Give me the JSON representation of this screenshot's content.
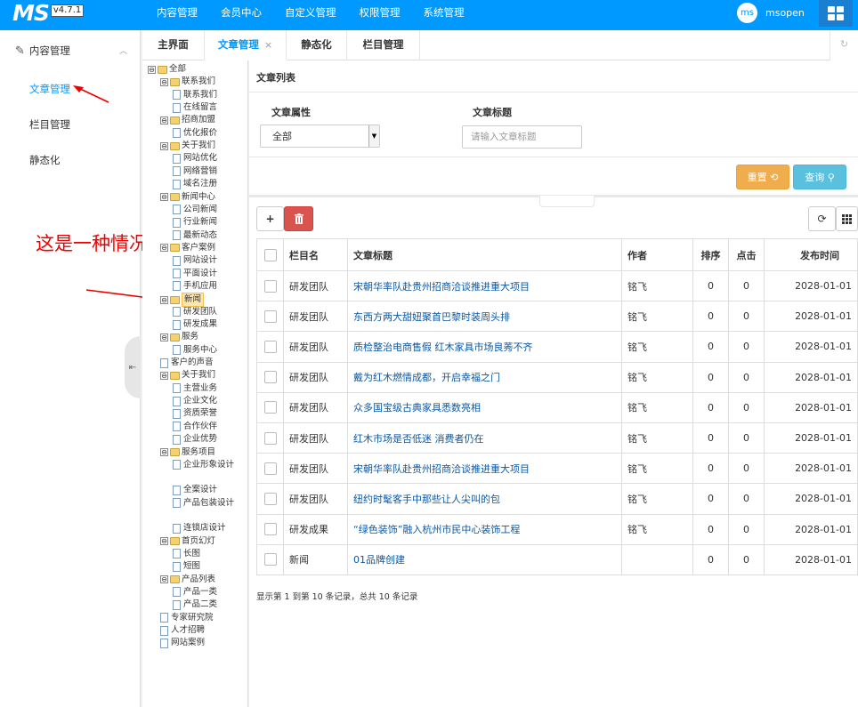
{
  "app": {
    "logo": "MS",
    "version": "v4.7.1"
  },
  "topnav": [
    "内容管理",
    "会员中心",
    "自定义管理",
    "权限管理",
    "系统管理"
  ],
  "user": {
    "avatar": "ms",
    "name": "msopen"
  },
  "sidebar": {
    "group": "内容管理",
    "items": [
      {
        "label": "文章管理",
        "active": true
      },
      {
        "label": "栏目管理",
        "active": false
      },
      {
        "label": "静态化",
        "active": false
      }
    ]
  },
  "annotation": {
    "text": "这是一种情况"
  },
  "tabs": [
    {
      "label": "主界面"
    },
    {
      "label": "文章管理",
      "close": "×"
    },
    {
      "label": "静态化"
    },
    {
      "label": "栏目管理"
    }
  ],
  "tree": [
    {
      "label": "全部",
      "type": "folder",
      "exp": "⊖"
    },
    {
      "label": "联系我们",
      "type": "folder",
      "exp": "⊖"
    },
    {
      "label": "联系我们",
      "type": "page"
    },
    {
      "label": "在线留言",
      "type": "page"
    },
    {
      "label": "招商加盟",
      "type": "folder",
      "exp": "⊖"
    },
    {
      "label": "优化报价",
      "type": "page"
    },
    {
      "label": "关于我们",
      "type": "folder",
      "exp": "⊖"
    },
    {
      "label": "网站优化",
      "type": "page"
    },
    {
      "label": "网络营销",
      "type": "page"
    },
    {
      "label": "域名注册",
      "type": "page"
    },
    {
      "label": "新闻中心",
      "type": "folder",
      "exp": "⊖"
    },
    {
      "label": "公司新闻",
      "type": "page"
    },
    {
      "label": "行业新闻",
      "type": "page"
    },
    {
      "label": "最新动态",
      "type": "page"
    },
    {
      "label": "客户案例",
      "type": "folder",
      "exp": "⊖"
    },
    {
      "label": "网站设计",
      "type": "page"
    },
    {
      "label": "平面设计",
      "type": "page"
    },
    {
      "label": "手机应用",
      "type": "page"
    },
    {
      "label": "新闻",
      "type": "folder",
      "exp": "⊖",
      "selected": true
    },
    {
      "label": "研发团队",
      "type": "page"
    },
    {
      "label": "研发成果",
      "type": "page"
    },
    {
      "label": "服务",
      "type": "folder",
      "exp": "⊖"
    },
    {
      "label": "服务中心",
      "type": "page"
    },
    {
      "label": "客户的声音",
      "type": "page"
    },
    {
      "label": "关于我们",
      "type": "folder",
      "exp": "⊖"
    },
    {
      "label": "主营业务",
      "type": "page"
    },
    {
      "label": "企业文化",
      "type": "page"
    },
    {
      "label": "资质荣誉",
      "type": "page"
    },
    {
      "label": "合作伙伴",
      "type": "page"
    },
    {
      "label": "企业优势",
      "type": "page"
    },
    {
      "label": "服务项目",
      "type": "folder",
      "exp": "⊖"
    },
    {
      "label": "企业形象设计",
      "type": "page",
      "wrap": true
    },
    {
      "label": "全案设计",
      "type": "page"
    },
    {
      "label": "产品包装设计",
      "type": "page",
      "wrap": true
    },
    {
      "label": "连锁店设计",
      "type": "page"
    },
    {
      "label": "首页幻灯",
      "type": "folder",
      "exp": "⊖"
    },
    {
      "label": "长图",
      "type": "page"
    },
    {
      "label": "短图",
      "type": "page"
    },
    {
      "label": "产品列表",
      "type": "folder",
      "exp": "⊖"
    },
    {
      "label": "产品一类",
      "type": "page"
    },
    {
      "label": "产品二类",
      "type": "page"
    },
    {
      "label": "专家研究院",
      "type": "page"
    },
    {
      "label": "人才招聘",
      "type": "page"
    },
    {
      "label": "网站案例",
      "type": "page"
    }
  ],
  "main": {
    "section_title": "文章列表",
    "filter": {
      "attr_label": "文章属性",
      "attr_value": "全部",
      "title_label": "文章标题",
      "title_placeholder": "请输入文章标题"
    },
    "buttons": {
      "reset": "重置",
      "query": "查询"
    },
    "toolbar": {
      "add": "+",
      "refresh": "⟳"
    },
    "table": {
      "columns": [
        "栏目名",
        "文章标题",
        "作者",
        "排序",
        "点击",
        "发布时间"
      ],
      "rows": [
        {
          "cat": "研发团队",
          "title": "宋朝华率队赴贵州招商洽谈推进重大项目",
          "author": "铭飞",
          "sort": "0",
          "hits": "0",
          "date": "2028-01-01"
        },
        {
          "cat": "研发团队",
          "title": "东西方两大甜妞聚首巴黎时装周头排",
          "author": "铭飞",
          "sort": "0",
          "hits": "0",
          "date": "2028-01-01"
        },
        {
          "cat": "研发团队",
          "title": "质检整治电商售假 红木家具市场良莠不齐",
          "author": "铭飞",
          "sort": "0",
          "hits": "0",
          "date": "2028-01-01"
        },
        {
          "cat": "研发团队",
          "title": "戴为红木燃情成都，开启幸福之门",
          "author": "铭飞",
          "sort": "0",
          "hits": "0",
          "date": "2028-01-01"
        },
        {
          "cat": "研发团队",
          "title": "众多国宝级古典家具悉数亮相",
          "author": "铭飞",
          "sort": "0",
          "hits": "0",
          "date": "2028-01-01"
        },
        {
          "cat": "研发团队",
          "title": "红木市场是否低迷 消费者仍在",
          "author": "铭飞",
          "sort": "0",
          "hits": "0",
          "date": "2028-01-01"
        },
        {
          "cat": "研发团队",
          "title": "宋朝华率队赴贵州招商洽谈推进重大项目",
          "author": "铭飞",
          "sort": "0",
          "hits": "0",
          "date": "2028-01-01"
        },
        {
          "cat": "研发团队",
          "title": "纽约时髦客手中那些让人尖叫的包",
          "author": "铭飞",
          "sort": "0",
          "hits": "0",
          "date": "2028-01-01"
        },
        {
          "cat": "研发成果",
          "title": "“绿色装饰”融入杭州市民中心装饰工程",
          "author": "铭飞",
          "sort": "0",
          "hits": "0",
          "date": "2028-01-01"
        },
        {
          "cat": "新闻",
          "title": "01品牌创建",
          "author": "",
          "sort": "0",
          "hits": "0",
          "date": "2028-01-01"
        }
      ]
    },
    "pager": "显示第 1 到第 10 条记录，总共 10 条记录"
  }
}
